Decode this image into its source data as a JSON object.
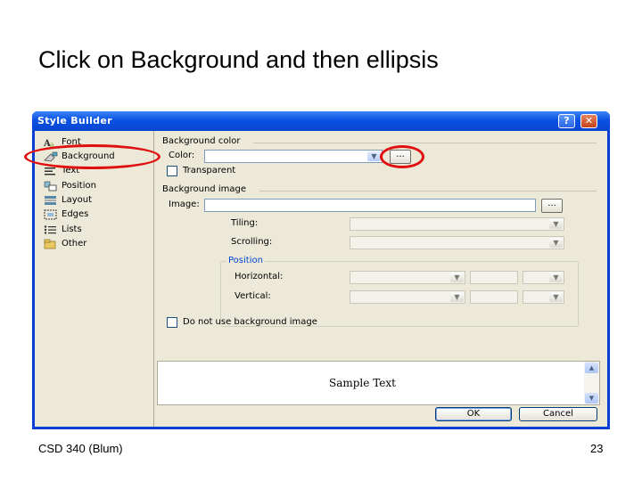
{
  "slide": {
    "title": "Click on Background and then ellipsis",
    "footer_left": "CSD 340 (Blum)",
    "page_number": "23"
  },
  "dialog": {
    "title": "Style Builder",
    "help_label": "?",
    "close_label": "✕",
    "sidebar": {
      "items": [
        {
          "label": "Font",
          "icon": "font-icon"
        },
        {
          "label": "Background",
          "icon": "background-icon"
        },
        {
          "label": "Text",
          "icon": "text-icon"
        },
        {
          "label": "Position",
          "icon": "position-icon"
        },
        {
          "label": "Layout",
          "icon": "layout-icon"
        },
        {
          "label": "Edges",
          "icon": "edges-icon"
        },
        {
          "label": "Lists",
          "icon": "lists-icon"
        },
        {
          "label": "Other",
          "icon": "other-icon"
        }
      ],
      "selected": "Background"
    },
    "background_color": {
      "section": "Background color",
      "color_label": "Color:",
      "color_value": "",
      "ellipsis_label": "...",
      "transparent_label": "Transparent"
    },
    "background_image": {
      "section": "Background image",
      "image_label": "Image:",
      "image_value": "",
      "ellipsis_label": "...",
      "tiling_label": "Tiling:",
      "scrolling_label": "Scrolling:",
      "position_group": "Position",
      "horizontal_label": "Horizontal:",
      "vertical_label": "Vertical:",
      "no_bg_label": "Do not use background image"
    },
    "preview": {
      "sample_text": "Sample Text"
    },
    "ok_label": "OK",
    "cancel_label": "Cancel"
  },
  "colors": {
    "highlight_ring": "#e01010",
    "titlebar": "#0a52e3",
    "dialog_face": "#ece9d8"
  }
}
